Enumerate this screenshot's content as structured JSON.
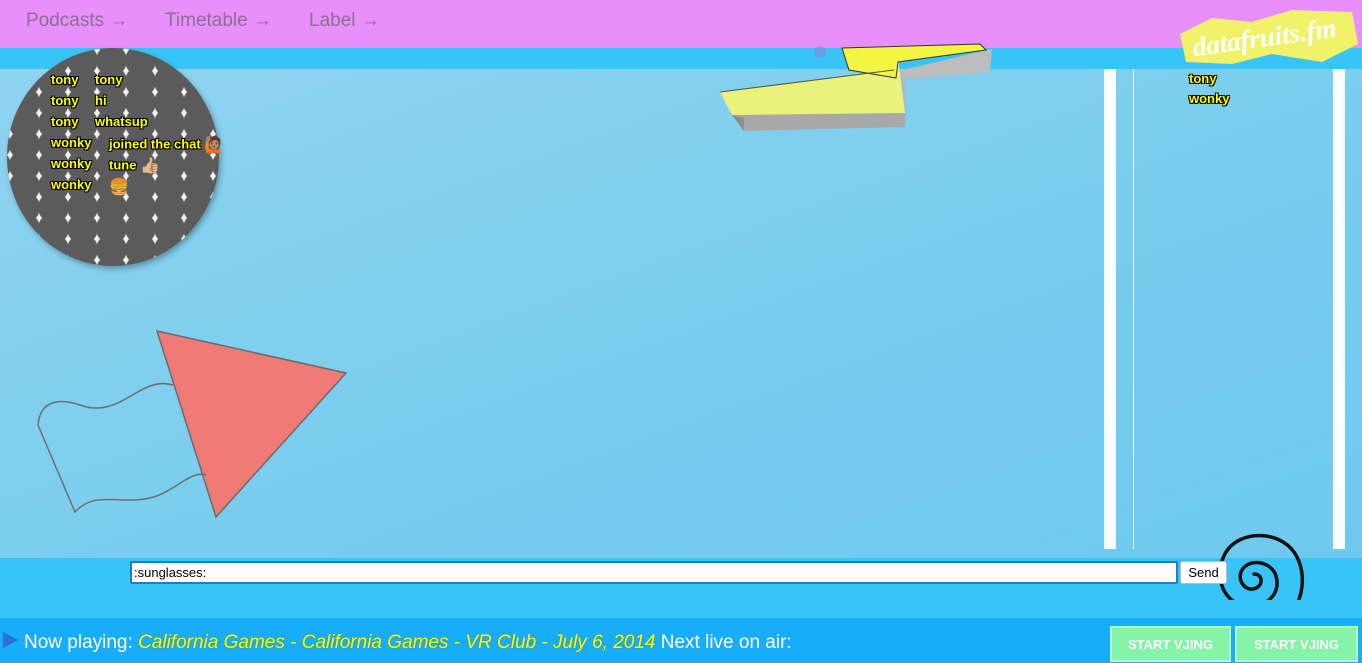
{
  "nav": {
    "links": [
      "Podcasts →",
      "Timetable →",
      "Label →"
    ],
    "logo": "datafruits.fm"
  },
  "chat": {
    "messages": [
      {
        "user": "tony",
        "text": "tony"
      },
      {
        "user": "tony",
        "text": "hi"
      },
      {
        "user": "tony",
        "text": "whatsup"
      },
      {
        "user": "wonky",
        "text": "joined the chat",
        "emoji": "🙋🏽"
      },
      {
        "user": "wonky",
        "text": "tune",
        "emoji": "👍🏼"
      },
      {
        "user": "wonky",
        "text": "",
        "emoji": "🍔"
      }
    ],
    "input_value": ":sunglasses:",
    "send_label": "Send"
  },
  "users": [
    "tony",
    "wonky"
  ],
  "player": {
    "prefix": "Now playing:",
    "track": "California Games - California Games - VR Club - July 6, 2014",
    "next_label": "Next live on air:"
  },
  "vjing": {
    "button1": "START VJING",
    "button2": "START VJING"
  },
  "colors": {
    "nav_bg": "#e98ffb",
    "page_bg": "#38c4f6",
    "chat_text": "#ffff00",
    "vj_button": "#86f4a8"
  }
}
